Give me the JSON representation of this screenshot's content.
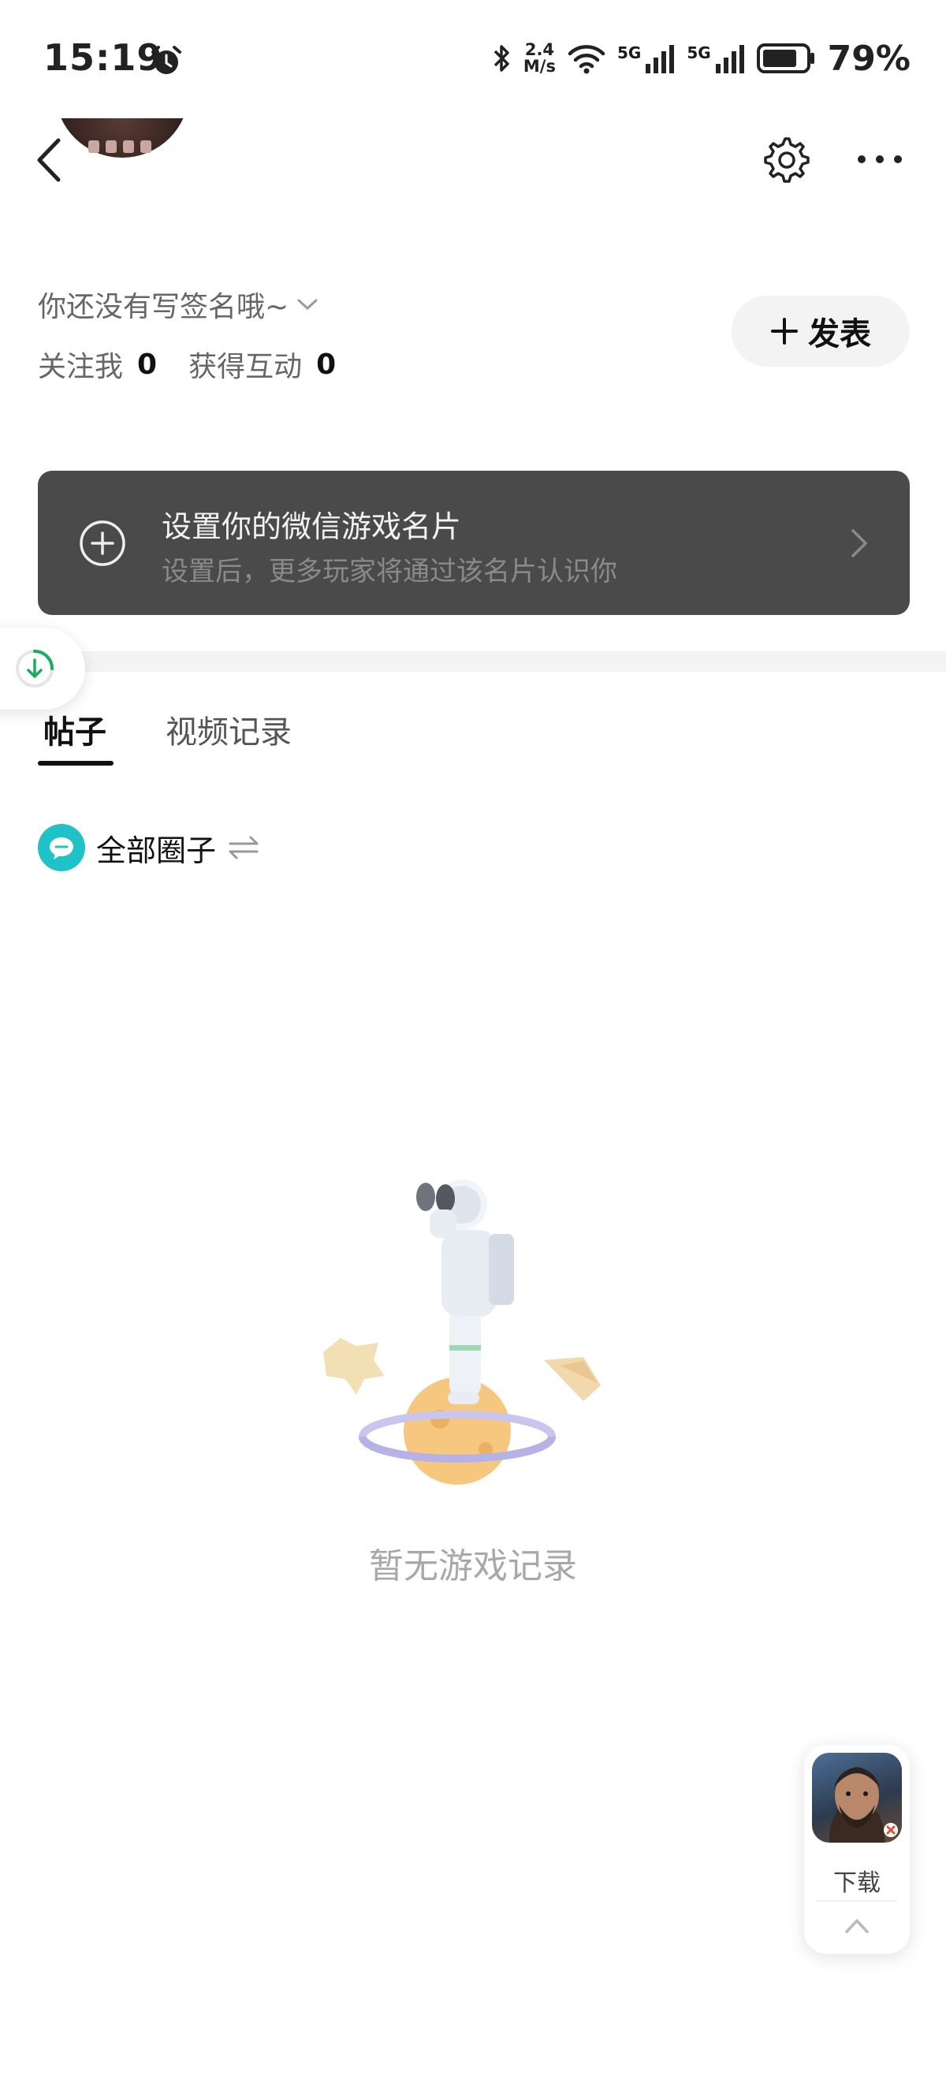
{
  "status_bar": {
    "time": "15:19",
    "net_speed_value": "2.4",
    "net_speed_unit": "M/s",
    "signal_1": "5G",
    "signal_2": "5G",
    "battery": "79%"
  },
  "profile": {
    "signature": "你还没有写签名哦~",
    "follow_label": "关注我",
    "follow_count": "0",
    "interaction_label": "获得互动",
    "interaction_count": "0",
    "publish_label": "发表"
  },
  "banner": {
    "title": "设置你的微信游戏名片",
    "subtitle": "设置后，更多玩家将通过该名片认识你"
  },
  "tabs": [
    {
      "label": "帖子",
      "active": true
    },
    {
      "label": "视频记录",
      "active": false
    }
  ],
  "circle_filter": {
    "label": "全部圈子"
  },
  "empty_state": {
    "text": "暂无游戏记录"
  },
  "game_card": {
    "label": "下载"
  },
  "colors": {
    "teal": "#1fc2c6",
    "banner_bg": "#4a4a4a",
    "accent_green": "#1aad5a"
  }
}
